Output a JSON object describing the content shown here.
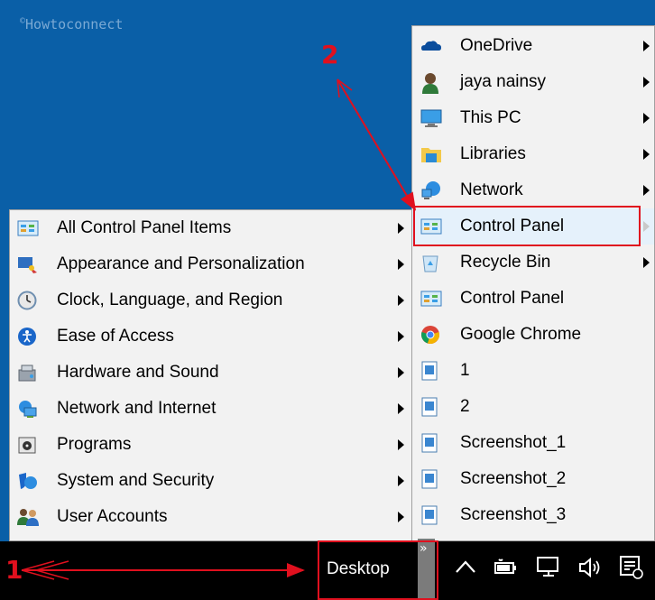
{
  "watermark": "Howtoconnect",
  "watermark_copy": "©",
  "right_menu": {
    "items": [
      {
        "label": "OneDrive",
        "icon": "onedrive-icon",
        "submenu": true
      },
      {
        "label": "jaya nainsy",
        "icon": "user-icon",
        "submenu": true
      },
      {
        "label": "This PC",
        "icon": "this-pc-icon",
        "submenu": true
      },
      {
        "label": "Libraries",
        "icon": "libraries-icon",
        "submenu": true
      },
      {
        "label": "Network",
        "icon": "network-icon",
        "submenu": true
      },
      {
        "label": "Control Panel",
        "icon": "control-panel-icon",
        "submenu": true,
        "highlighted": true
      },
      {
        "label": "Recycle Bin",
        "icon": "recycle-bin-icon",
        "submenu": true
      },
      {
        "label": "Control Panel",
        "icon": "control-panel-icon",
        "submenu": false
      },
      {
        "label": "Google Chrome",
        "icon": "chrome-icon",
        "submenu": false
      },
      {
        "label": "1",
        "icon": "image-file-icon",
        "submenu": false
      },
      {
        "label": "2",
        "icon": "image-file-icon",
        "submenu": false
      },
      {
        "label": "Screenshot_1",
        "icon": "image-file-icon",
        "submenu": false
      },
      {
        "label": "Screenshot_2",
        "icon": "image-file-icon",
        "submenu": false
      },
      {
        "label": "Screenshot_3",
        "icon": "image-file-icon",
        "submenu": false
      }
    ]
  },
  "left_menu": {
    "items": [
      {
        "label": "All Control Panel Items",
        "icon": "control-panel-icon"
      },
      {
        "label": "Appearance and Personalization",
        "icon": "appearance-icon"
      },
      {
        "label": "Clock, Language, and Region",
        "icon": "clock-icon"
      },
      {
        "label": "Ease of Access",
        "icon": "ease-of-access-icon"
      },
      {
        "label": "Hardware and Sound",
        "icon": "hardware-icon"
      },
      {
        "label": "Network and Internet",
        "icon": "network-internet-icon"
      },
      {
        "label": "Programs",
        "icon": "programs-icon"
      },
      {
        "label": "System and Security",
        "icon": "security-icon"
      },
      {
        "label": "User Accounts",
        "icon": "user-accounts-icon"
      }
    ]
  },
  "taskbar": {
    "toolbar_label": "Desktop",
    "chevron": "»",
    "tray": [
      "^",
      "battery-icon",
      "network-tray-icon",
      "volume-icon",
      "action-center-icon"
    ]
  },
  "markers": {
    "one": "1",
    "two": "2"
  },
  "colors": {
    "desktop": "#0a5fa7",
    "menu": "#f2f2f2",
    "annotation": "#e0101e",
    "taskbar": "#000000"
  }
}
